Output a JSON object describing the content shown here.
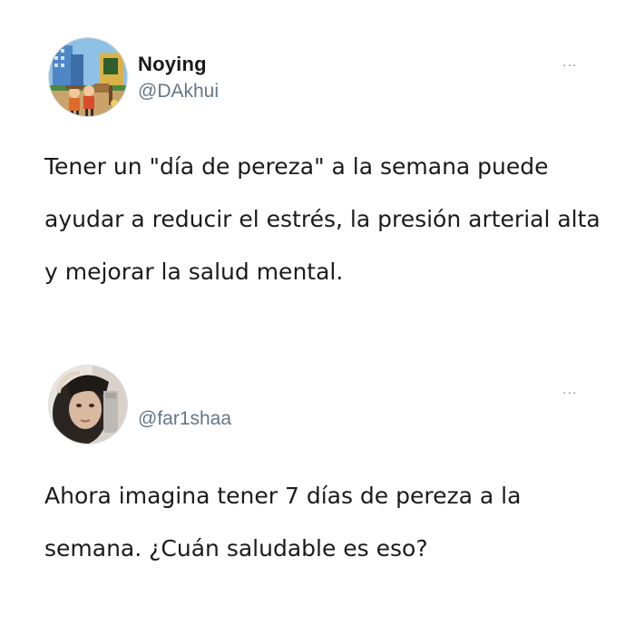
{
  "tweets": [
    {
      "name": "Noying",
      "handle": "@DAkhui",
      "more": "...",
      "avatar": "avatar-cartoon-workers",
      "text": "Tener un \"día de pereza\" a la semana puede ayudar a reducir el estrés, la presión arterial alta y mejorar la salud mental."
    },
    {
      "name": "",
      "handle": "@far1shaa",
      "more": "...",
      "avatar": "avatar-person-photo",
      "text": "Ahora imagina tener 7 días de pereza a la semana. ¿Cuán saludable es eso?"
    }
  ]
}
